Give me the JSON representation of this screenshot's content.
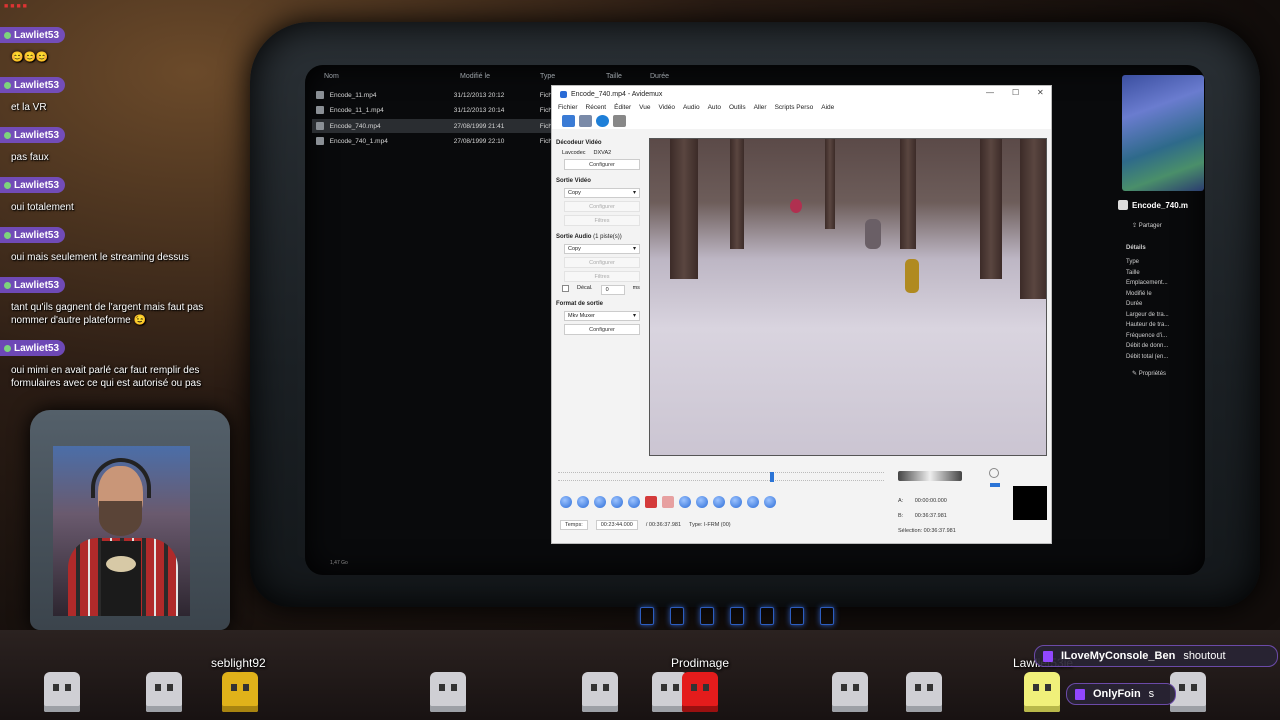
{
  "chat": {
    "messages": [
      {
        "user": "Lawliet53",
        "text": "😊😊😊"
      },
      {
        "user": "Lawliet53",
        "text": "et la VR"
      },
      {
        "user": "Lawliet53",
        "text": "pas faux"
      },
      {
        "user": "Lawliet53",
        "text": "oui totalement"
      },
      {
        "user": "Lawliet53",
        "text": "oui mais seulement le streaming dessus"
      },
      {
        "user": "Lawliet53",
        "text": "tant qu'ils gagnent de l'argent mais faut pas nommer d'autre plateforme 😉"
      },
      {
        "user": "Lawliet53",
        "text": "oui mimi en avait parlé car faut remplir des formulaires avec ce qui est autorisé ou pas"
      }
    ]
  },
  "explorer": {
    "columns": {
      "name": "Nom",
      "modified": "Modifié le",
      "type": "Type",
      "size": "Taille",
      "duration": "Durée"
    },
    "files": [
      {
        "name": "Encode_11.mp4",
        "date": "31/12/2013 20:12",
        "type": "Fich"
      },
      {
        "name": "Encode_11_1.mp4",
        "date": "31/12/2013 20:14",
        "type": "Fich"
      },
      {
        "name": "Encode_740.mp4",
        "date": "27/08/1999 21:41",
        "type": "Fich"
      },
      {
        "name": "Encode_740_1.mp4",
        "date": "27/08/1999 22:10",
        "type": "Fich"
      }
    ],
    "footer": "1,47 Go"
  },
  "avidemux": {
    "title": "Encode_740.mp4 - Avidemux",
    "menu": [
      "Fichier",
      "Récent",
      "Éditer",
      "Vue",
      "Vidéo",
      "Audio",
      "Auto",
      "Outils",
      "Aller",
      "Scripts Perso",
      "Aide"
    ],
    "video_decoder": {
      "label": "Décodeur Vidéo",
      "lavcodec_label": "Lavcodec",
      "codec": "DXVA2",
      "configure": "Configurer"
    },
    "video_output": {
      "label": "Sortie Vidéo",
      "value": "Copy",
      "configure": "Configurer",
      "filters": "Filtres"
    },
    "audio_output": {
      "label": "Sortie Audio",
      "tracks": "(1 piste(s))",
      "value": "Copy",
      "configure": "Configurer",
      "filters": "Filtres",
      "shift_label": "Décal.",
      "shift_value": "0",
      "shift_unit": "ms"
    },
    "output_format": {
      "label": "Format de sortie",
      "value": "Mkv Muxer",
      "configure": "Configurer"
    },
    "time_label": "Temps:",
    "current_time": "00:23:44.000",
    "total_time": "/ 00:36:37.981",
    "frame_type": "Type: I-FRM (00)",
    "marker_a_label": "A:",
    "marker_a": "00:00:00.000",
    "marker_b_label": "B:",
    "marker_b": "00:36:37.981",
    "selection": "Sélection: 00:36:37.981",
    "seek_position": 0.65
  },
  "properties": {
    "filename": "Encode_740.m",
    "share": "Partager",
    "details_header": "Détails",
    "fields": [
      "Type",
      "Taille",
      "Emplacement...",
      "Modifié le",
      "Durée",
      "Largeur de tra...",
      "Hauteur de tra...",
      "Fréquence d'i...",
      "Débit de donn...",
      "Débit total (en..."
    ],
    "props_button": "Propriétés"
  },
  "viewers": [
    {
      "name": "seblight92"
    },
    {
      "name": "Prodimage"
    },
    {
      "name": "Lawliet53ie"
    }
  ],
  "alerts": [
    {
      "user": "ILoveMyConsole_Ben",
      "action": "shoutout"
    },
    {
      "user": "OnlyFoin",
      "action": "s"
    }
  ]
}
